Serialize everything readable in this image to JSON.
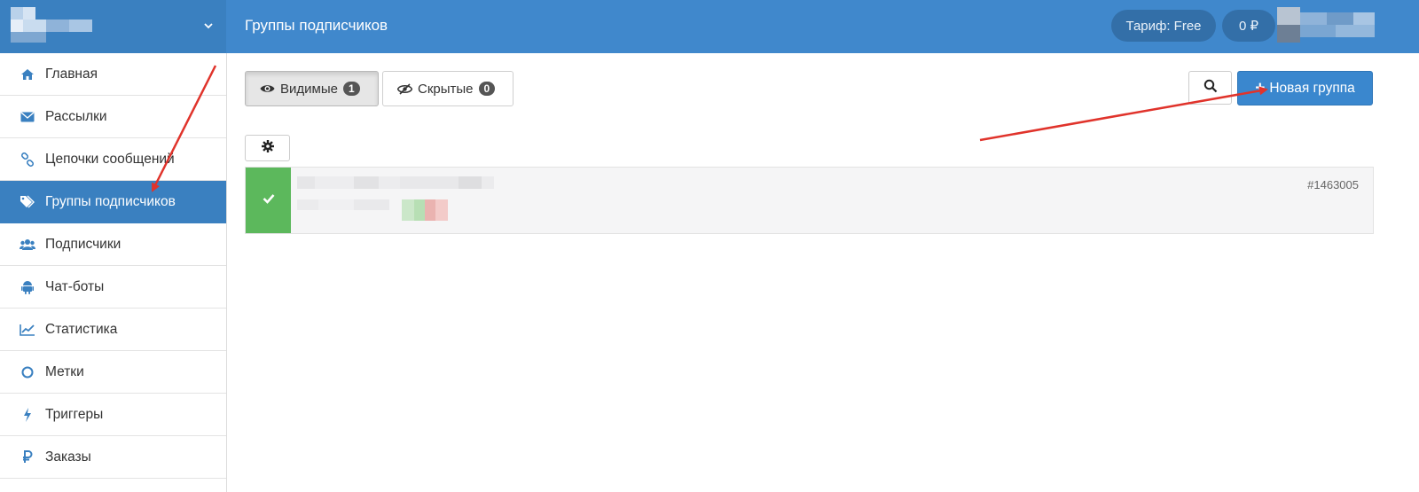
{
  "header": {
    "title": "Группы подписчиков",
    "tariff": "Тариф: Free",
    "balance": "0 ₽"
  },
  "sidebar": {
    "items": [
      {
        "label": "Главная",
        "icon": "home-icon"
      },
      {
        "label": "Рассылки",
        "icon": "envelope-icon"
      },
      {
        "label": "Цепочки сообщений",
        "icon": "link-icon"
      },
      {
        "label": "Группы подписчиков",
        "icon": "tags-icon",
        "active": true
      },
      {
        "label": "Подписчики",
        "icon": "users-icon"
      },
      {
        "label": "Чат-боты",
        "icon": "android-icon"
      },
      {
        "label": "Статистика",
        "icon": "line-chart-icon"
      },
      {
        "label": "Метки",
        "icon": "circle-icon"
      },
      {
        "label": "Триггеры",
        "icon": "bolt-icon"
      },
      {
        "label": "Заказы",
        "icon": "ruble-icon"
      }
    ]
  },
  "tabs": {
    "visible": {
      "label": "Видимые",
      "count": "1"
    },
    "hidden": {
      "label": "Скрытые",
      "count": "0"
    }
  },
  "toolbar": {
    "new_group_label": "Новая группа"
  },
  "groups": [
    {
      "id": "#1463005"
    }
  ],
  "colors": {
    "header_bg": "#4088cc",
    "accent": "#3a80c0",
    "success": "#5cb85c",
    "annotation_arrow": "#e0332b"
  }
}
